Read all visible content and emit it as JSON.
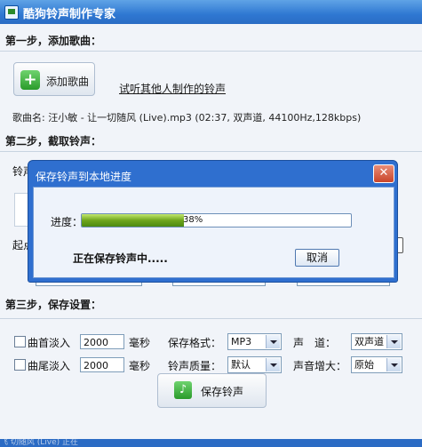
{
  "window": {
    "title": "酷狗铃声制作专家",
    "icon": "app-icon"
  },
  "step1": {
    "title": "第一步，添加歌曲：",
    "add_button": "添加歌曲",
    "listen_link": "试听其他人制作的铃声",
    "song_info": "歌曲名: 汪小敏 - 让一切随风 (Live).mp3  (02:37, 双声道, 44100Hz,128kbps)"
  },
  "step2": {
    "title": "第二步，截取铃声：",
    "row_label_partial": "铃声",
    "start_label_partial": "起点"
  },
  "step3": {
    "title": "第三步，保存设置：",
    "fade_in_label": "曲首淡入",
    "fade_in_value": "2000",
    "fade_out_label": "曲尾淡入",
    "fade_out_value": "2000",
    "ms_unit": "毫秒",
    "format_label": "保存格式：",
    "format_value": "MP3",
    "quality_label": "铃声质量：",
    "quality_value": "默认",
    "channel_label": "声　道：",
    "channel_value": "双声道",
    "boost_label": "声音增大：",
    "boost_value": "原始",
    "save_button": "保存铃声"
  },
  "dialog": {
    "title": "保存铃声到本地进度",
    "progress_label": "进度：",
    "progress_value": 0.38,
    "progress_text": "38%",
    "status_text": "正在保存铃声中.....",
    "cancel_button": "取消",
    "close_icon": "close-icon"
  },
  "statusbar": {
    "text": "飞  切随风 (Live) 正在"
  },
  "colors": {
    "titlebar": "#2f78d2",
    "progress": "#6ea61c",
    "close": "#c9452a"
  }
}
